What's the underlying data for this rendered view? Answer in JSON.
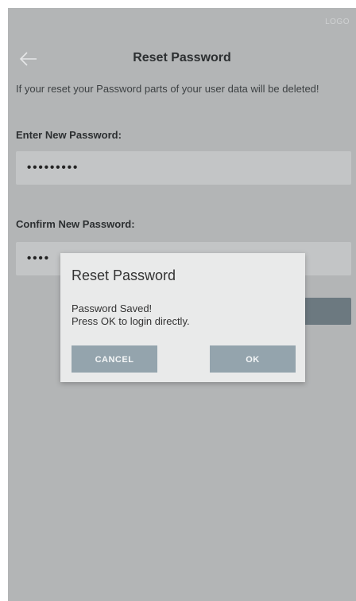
{
  "status": {
    "logo_text": "LOGO"
  },
  "header": {
    "title": "Reset Password",
    "back_icon": "arrow-left-icon"
  },
  "warning_text": "If your reset your Password parts of your user data will be deleted!",
  "new_password": {
    "label": "Enter New Password:",
    "value": "•••••••••"
  },
  "confirm_password": {
    "label": "Confirm New Password:",
    "value": "••••"
  },
  "dialog": {
    "title": "Reset Password",
    "message_line1": "Password Saved!",
    "message_line2": "Press OK to login directly.",
    "cancel_label": "CANCEL",
    "ok_label": "OK"
  },
  "colors": {
    "overlay_background": "#b3b5b6",
    "dialog_background": "#e9eaea",
    "dialog_button": "#94a4ad",
    "primary_button": "#6c7980"
  }
}
